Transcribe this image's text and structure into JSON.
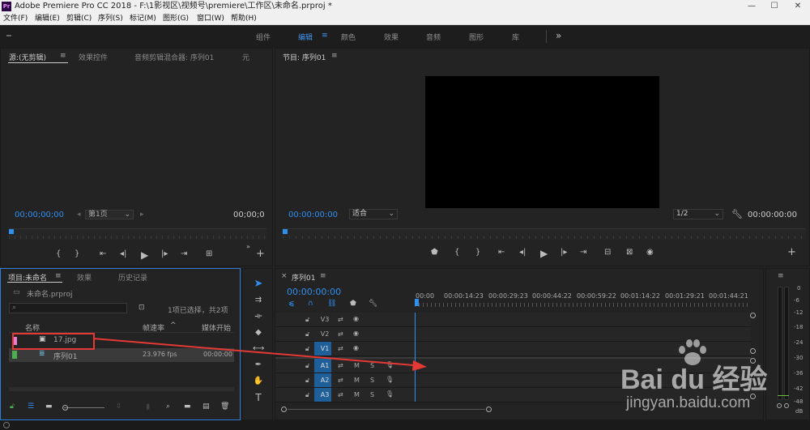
{
  "app": {
    "logo": "Pr",
    "title": "Adobe Premiere Pro CC 2018 - F:\\1影视区\\视频号\\premiere\\工作区\\未命名.prproj *",
    "min": "—",
    "max": "☐",
    "close": "✕"
  },
  "menu": [
    "文件(F)",
    "编辑(E)",
    "剪辑(C)",
    "序列(S)",
    "标记(M)",
    "图形(G)",
    "窗口(W)",
    "帮助(H)"
  ],
  "workspaces": [
    "组件",
    "编辑",
    "颜色",
    "效果",
    "音频",
    "图形",
    "库"
  ],
  "workspace_active": "编辑",
  "workspace_more": "»",
  "source_panel": {
    "tabs": [
      "源:(无剪辑)",
      "效果控件",
      "音频剪辑混合器: 序列01",
      "元"
    ],
    "timecode_left": "00;00;00;00",
    "page_select": "第1页",
    "timecode_right": "00;00;0"
  },
  "program_panel": {
    "title": "节目: 序列01",
    "timecode_left": "00:00:00:00",
    "fit": "适合",
    "quality": "1/2",
    "timecode_right": "00:00:00:00"
  },
  "project_panel": {
    "tabs": [
      "项目:未命名",
      "效果",
      "历史记录"
    ],
    "file": "未命名.prproj",
    "selection": "1项已选择，共2项",
    "columns": [
      "名称",
      "帧速率",
      "媒体开始"
    ],
    "items": [
      {
        "name": "17.jpg",
        "fps": "",
        "start": "",
        "color": "#e87bd6"
      },
      {
        "name": "序列01",
        "fps": "23.976 fps",
        "start": "00:00:00",
        "color": "#4caf50"
      }
    ]
  },
  "timeline_panel": {
    "tab": "序列01",
    "timecode": "00:00:00:00",
    "ruler_labels": [
      "00:00",
      "00:00:14:23",
      "00:00:29:23",
      "00:00:44:22",
      "00:00:59:22",
      "00:01:14:22",
      "00:01:29:21",
      "00:01:44:21"
    ],
    "video_tracks": [
      "V3",
      "V2",
      "V1"
    ],
    "audio_tracks": [
      "A1",
      "A2",
      "A3"
    ],
    "m": "M",
    "s": "S"
  },
  "meter": {
    "scale": [
      "0",
      "-6",
      "-12",
      "-18",
      "-24",
      "-30",
      "-36",
      "-42",
      "-48",
      "dB"
    ]
  },
  "watermark": {
    "brand": "Bai  du 经验",
    "url": "jingyan.baidu.com"
  }
}
